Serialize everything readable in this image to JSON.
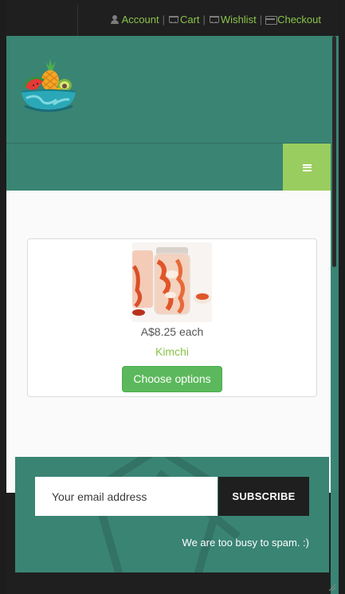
{
  "topbar": {
    "links": [
      {
        "label": "Account",
        "icon": "user-icon"
      },
      {
        "label": "Cart",
        "icon": "cart-icon"
      },
      {
        "label": "Wishlist",
        "icon": "cart-icon"
      },
      {
        "label": "Checkout",
        "icon": "credit-card-icon"
      }
    ],
    "separator": "|"
  },
  "header": {
    "logo_icon": "fruit-bowl-logo"
  },
  "navbar": {
    "menu_icon": "hamburger-menu-icon"
  },
  "product": {
    "price": "A$8.25 each",
    "name": "Kimchi",
    "button_label": "Choose options",
    "image_icon": "kimchi-jar-image"
  },
  "newsletter": {
    "placeholder": "Your email address",
    "button_label": "SUBSCRIBE",
    "note": "We are too busy to spam. :)"
  },
  "colors": {
    "primary": "#3a8474",
    "accent": "#8bc34a",
    "button_green": "#5cb85c",
    "dark": "#1f1f1f"
  }
}
